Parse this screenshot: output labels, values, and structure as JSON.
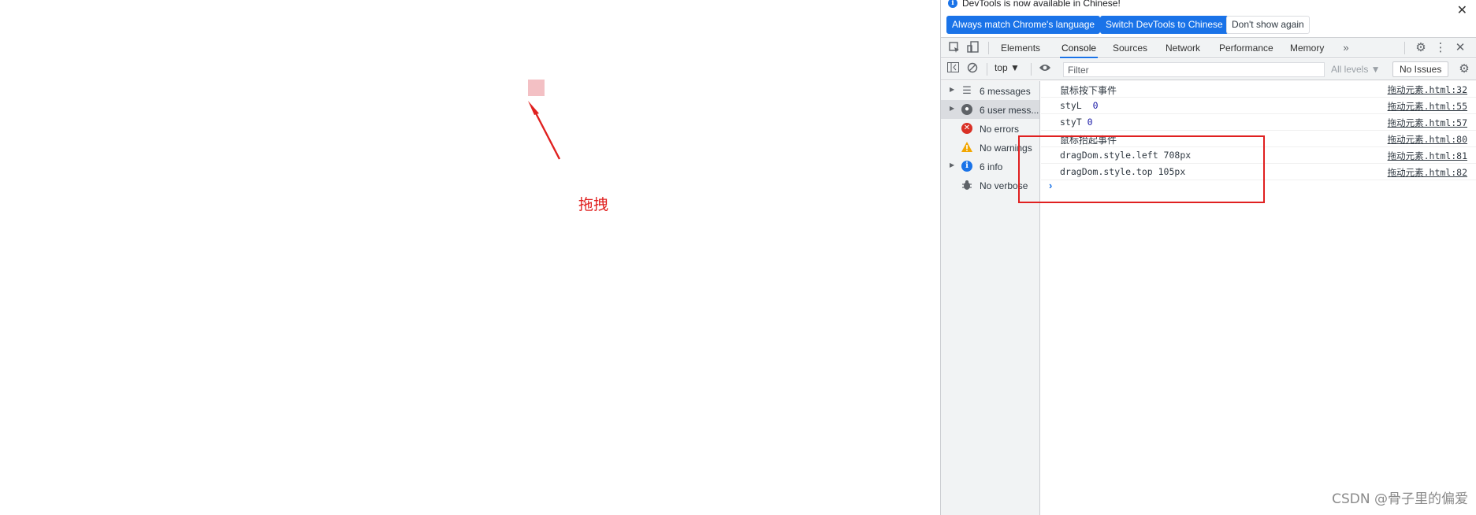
{
  "page": {
    "drag_label": "拖拽",
    "box_color": "#f3c0c4",
    "annotation_color": "#e0201f"
  },
  "devtools": {
    "infobar": {
      "message": "DevTools is now available in Chinese!",
      "buttons": [
        "Always match Chrome's language",
        "Switch DevTools to Chinese",
        "Don't show again"
      ]
    },
    "tabs": [
      "Elements",
      "Console",
      "Sources",
      "Network",
      "Performance",
      "Memory"
    ],
    "active_tab": "Console",
    "toolbar": {
      "context": "top ▼",
      "filter_placeholder": "Filter",
      "levels": "All levels ▼",
      "issues": "No Issues"
    },
    "sidebar": [
      {
        "label": "6 messages",
        "icon": "list-icon",
        "expandable": true
      },
      {
        "label": "6 user mess...",
        "icon": "user-icon",
        "expandable": true,
        "selected": true
      },
      {
        "label": "No errors",
        "icon": "error-icon",
        "expandable": false
      },
      {
        "label": "No warnings",
        "icon": "warning-icon",
        "expandable": false
      },
      {
        "label": "6 info",
        "icon": "info-icon",
        "expandable": true
      },
      {
        "label": "No verbose",
        "icon": "bug-icon",
        "expandable": false
      }
    ],
    "logs": [
      {
        "text": "鼠标按下事件",
        "source": "拖动元素.html:32"
      },
      {
        "text": "styL",
        "value": "0",
        "source": "拖动元素.html:55"
      },
      {
        "text": "styT",
        "value": "0",
        "source": "拖动元素.html:57"
      },
      {
        "text": "鼠标抬起事件",
        "source": "拖动元素.html:80"
      },
      {
        "text": "dragDom.style.left 708px",
        "source": "拖动元素.html:81"
      },
      {
        "text": "dragDom.style.top 105px",
        "source": "拖动元素.html:82"
      }
    ]
  },
  "watermark": "CSDN @骨子里的偏爱"
}
